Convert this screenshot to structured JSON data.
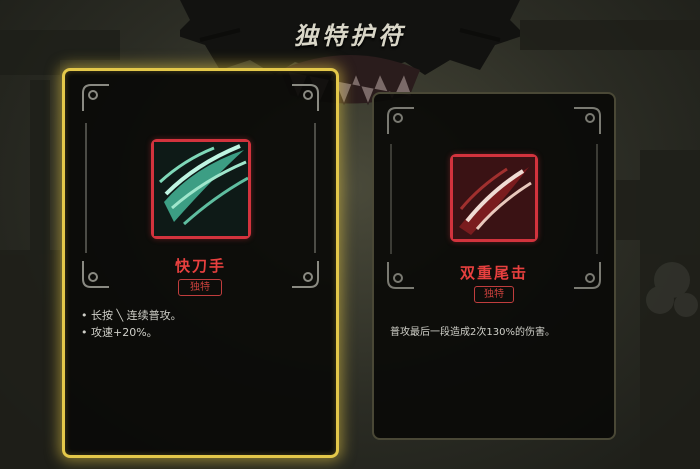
{
  "header": {
    "title": "独特护符"
  },
  "cards": [
    {
      "name": "快刀手",
      "badge": "独特",
      "icon": "blade-slash-icon",
      "selected": true,
      "lines": [
        "• 长按 ╲ 连续普攻。",
        "• 攻速+20%。"
      ]
    },
    {
      "name": "双重尾击",
      "badge": "独特",
      "icon": "claw-slash-icon",
      "selected": false,
      "lines": [
        "普攻最后一段造成2次130%的伤害。"
      ]
    }
  ],
  "colors": {
    "accent_gold": "#e4c84a",
    "accent_red": "#d2333d",
    "card_bg": "#0a0a08"
  }
}
